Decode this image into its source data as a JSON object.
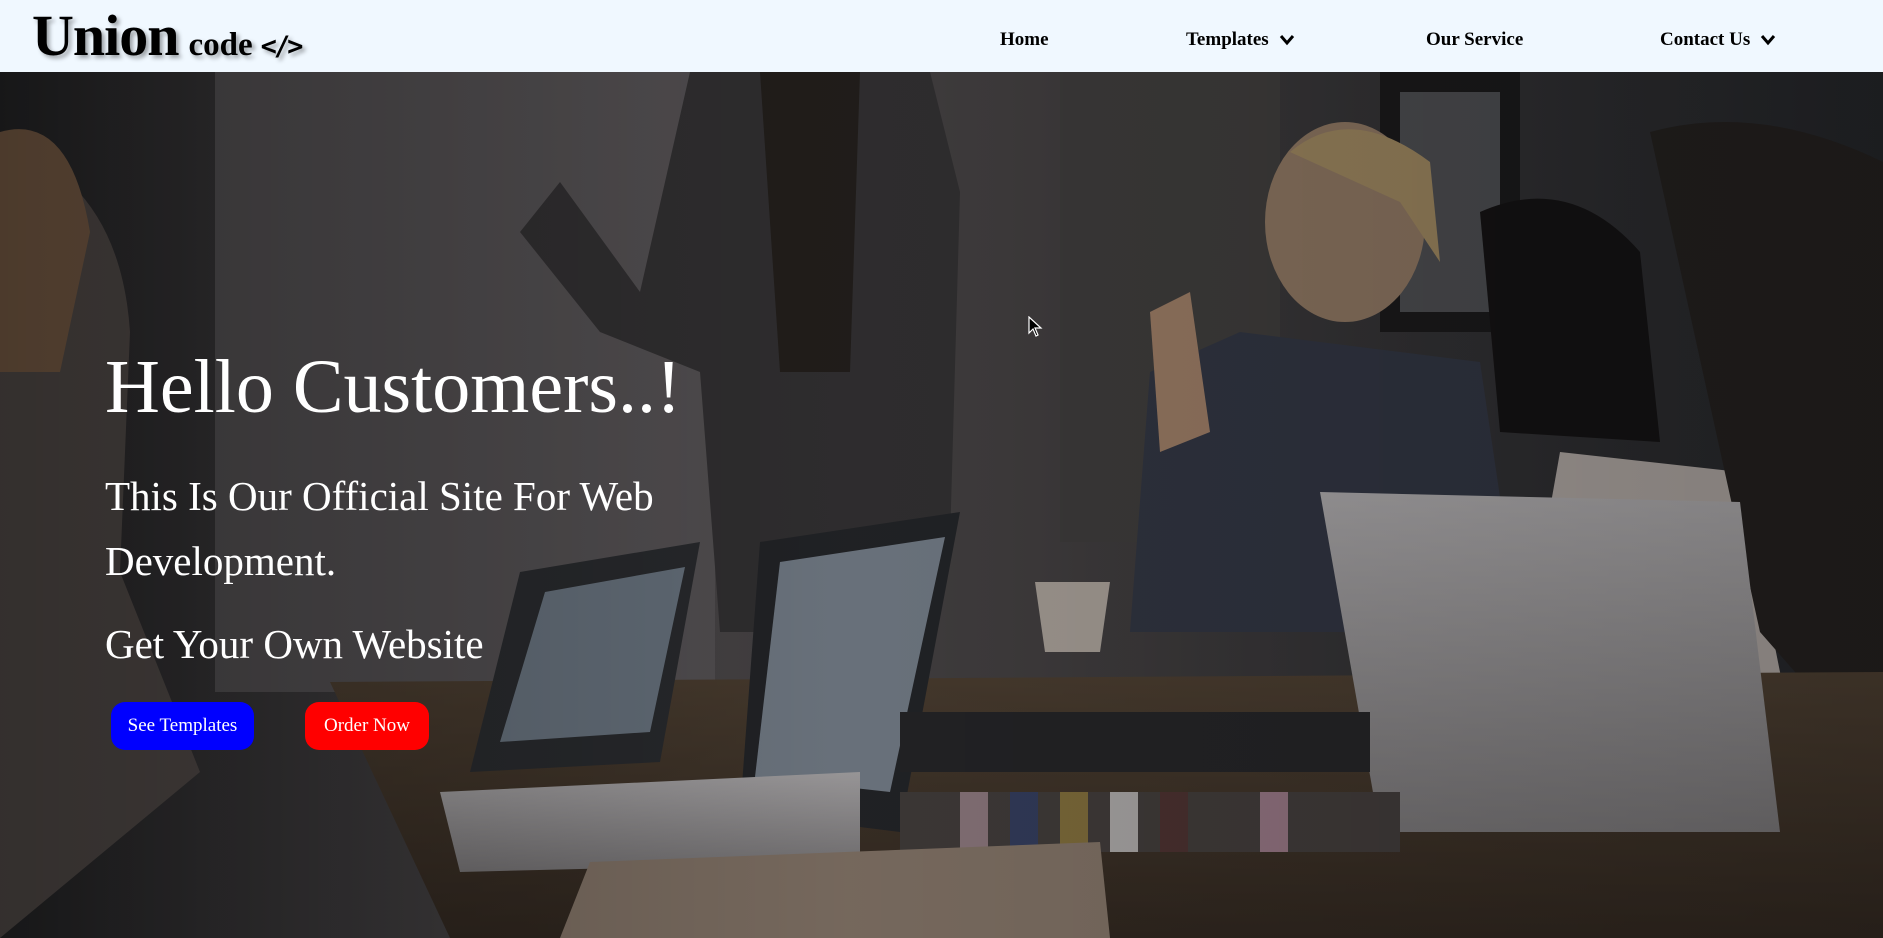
{
  "logo": {
    "main": "Union",
    "sub": "code",
    "icon": "</>"
  },
  "nav": {
    "home": "Home",
    "templates": "Templates",
    "service": "Our Service",
    "contact": "Contact Us"
  },
  "hero": {
    "title": "Hello Customers..!",
    "subtitle": "This Is Our Official Site For Web Development.",
    "cta": "Get Your Own Website",
    "buttons": {
      "templates": "See Templates",
      "order": "Order Now"
    }
  },
  "colors": {
    "navbar_bg": "#f0f8ff",
    "button_blue": "#0000ff",
    "button_red": "#ff0000"
  },
  "icons": {
    "dropdown": "chevron-down-icon",
    "cursor": "mouse-pointer-icon"
  }
}
